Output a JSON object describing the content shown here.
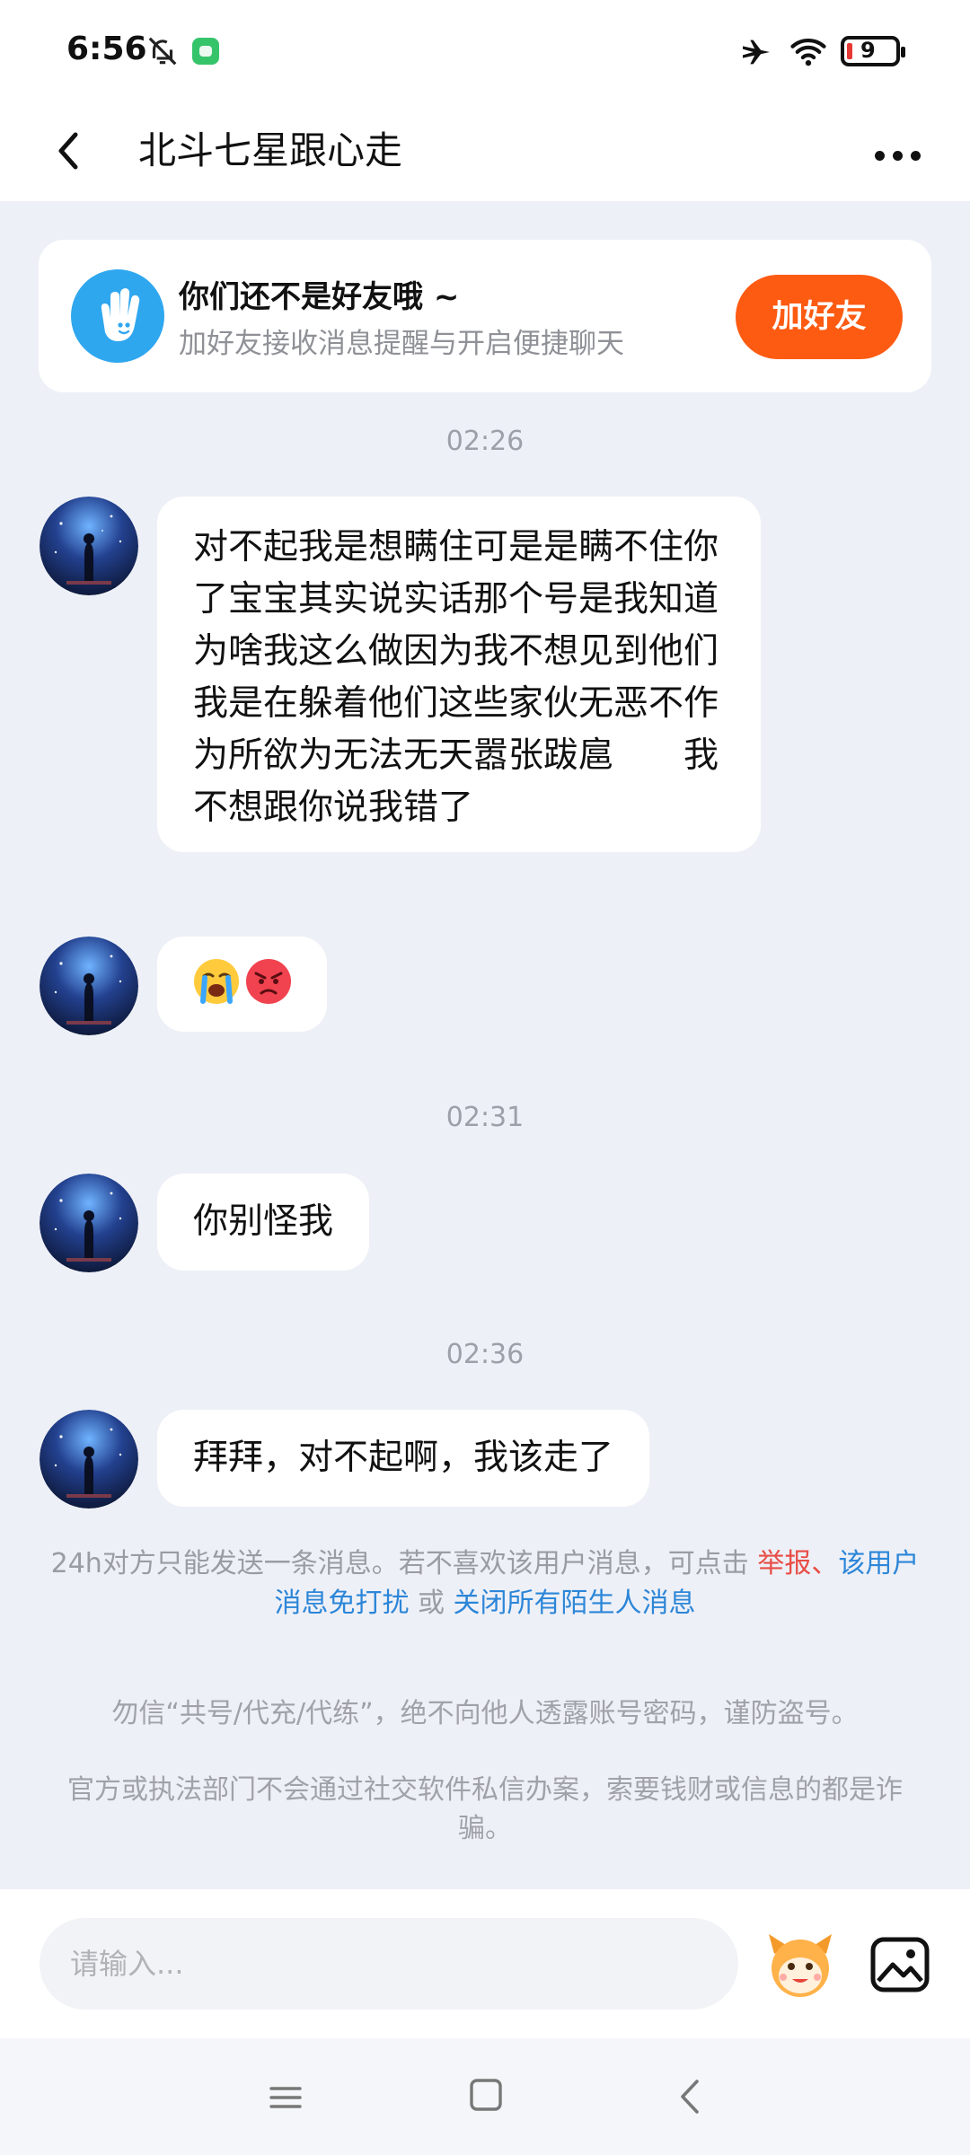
{
  "status_bar": {
    "time": "6:56",
    "battery": "9"
  },
  "header": {
    "title": "北斗七星跟心走"
  },
  "friend_card": {
    "title": "你们还不是好友哦 ~",
    "subtitle": "加好友接收消息提醒与开启便捷聊天",
    "add_button": "加好友"
  },
  "messages": [
    {
      "timestamp": "02:26"
    },
    {
      "text": "对不起我是想瞒住可是是瞒不住你了宝宝其实说实话那个号是我知道为啥我这么做因为我不想见到他们我是在躲着他们这些家伙无恶不作为所欲为无法无天嚣张跋扈　　我不想跟你说我错了"
    },
    {
      "emojis": [
        "loudly-crying-face",
        "angry-face"
      ]
    },
    {
      "timestamp": "02:31"
    },
    {
      "text": "你别怪我"
    },
    {
      "timestamp": "02:36"
    },
    {
      "text": "拜拜，对不起啊，我该走了"
    }
  ],
  "notice": {
    "prefix": "24h对方只能发送一条消息。若不喜欢该用户消息，可点击 ",
    "report": "举报",
    "sep": "、",
    "mute": "该用户消息免打扰",
    "or": " 或 ",
    "close_all": "关闭所有陌生人消息"
  },
  "warnings": [
    "勿信“共号/代充/代练”，绝不向他人透露账号密码，谨防盗号。",
    "官方或执法部门不会通过社交软件私信办案，索要钱财或信息的都是诈骗。"
  ],
  "input": {
    "placeholder": "请输入..."
  },
  "colors": {
    "accent": "#fd5a12",
    "link_blue": "#2c86d8",
    "link_red": "#e84d46",
    "background": "#eef0f7"
  }
}
